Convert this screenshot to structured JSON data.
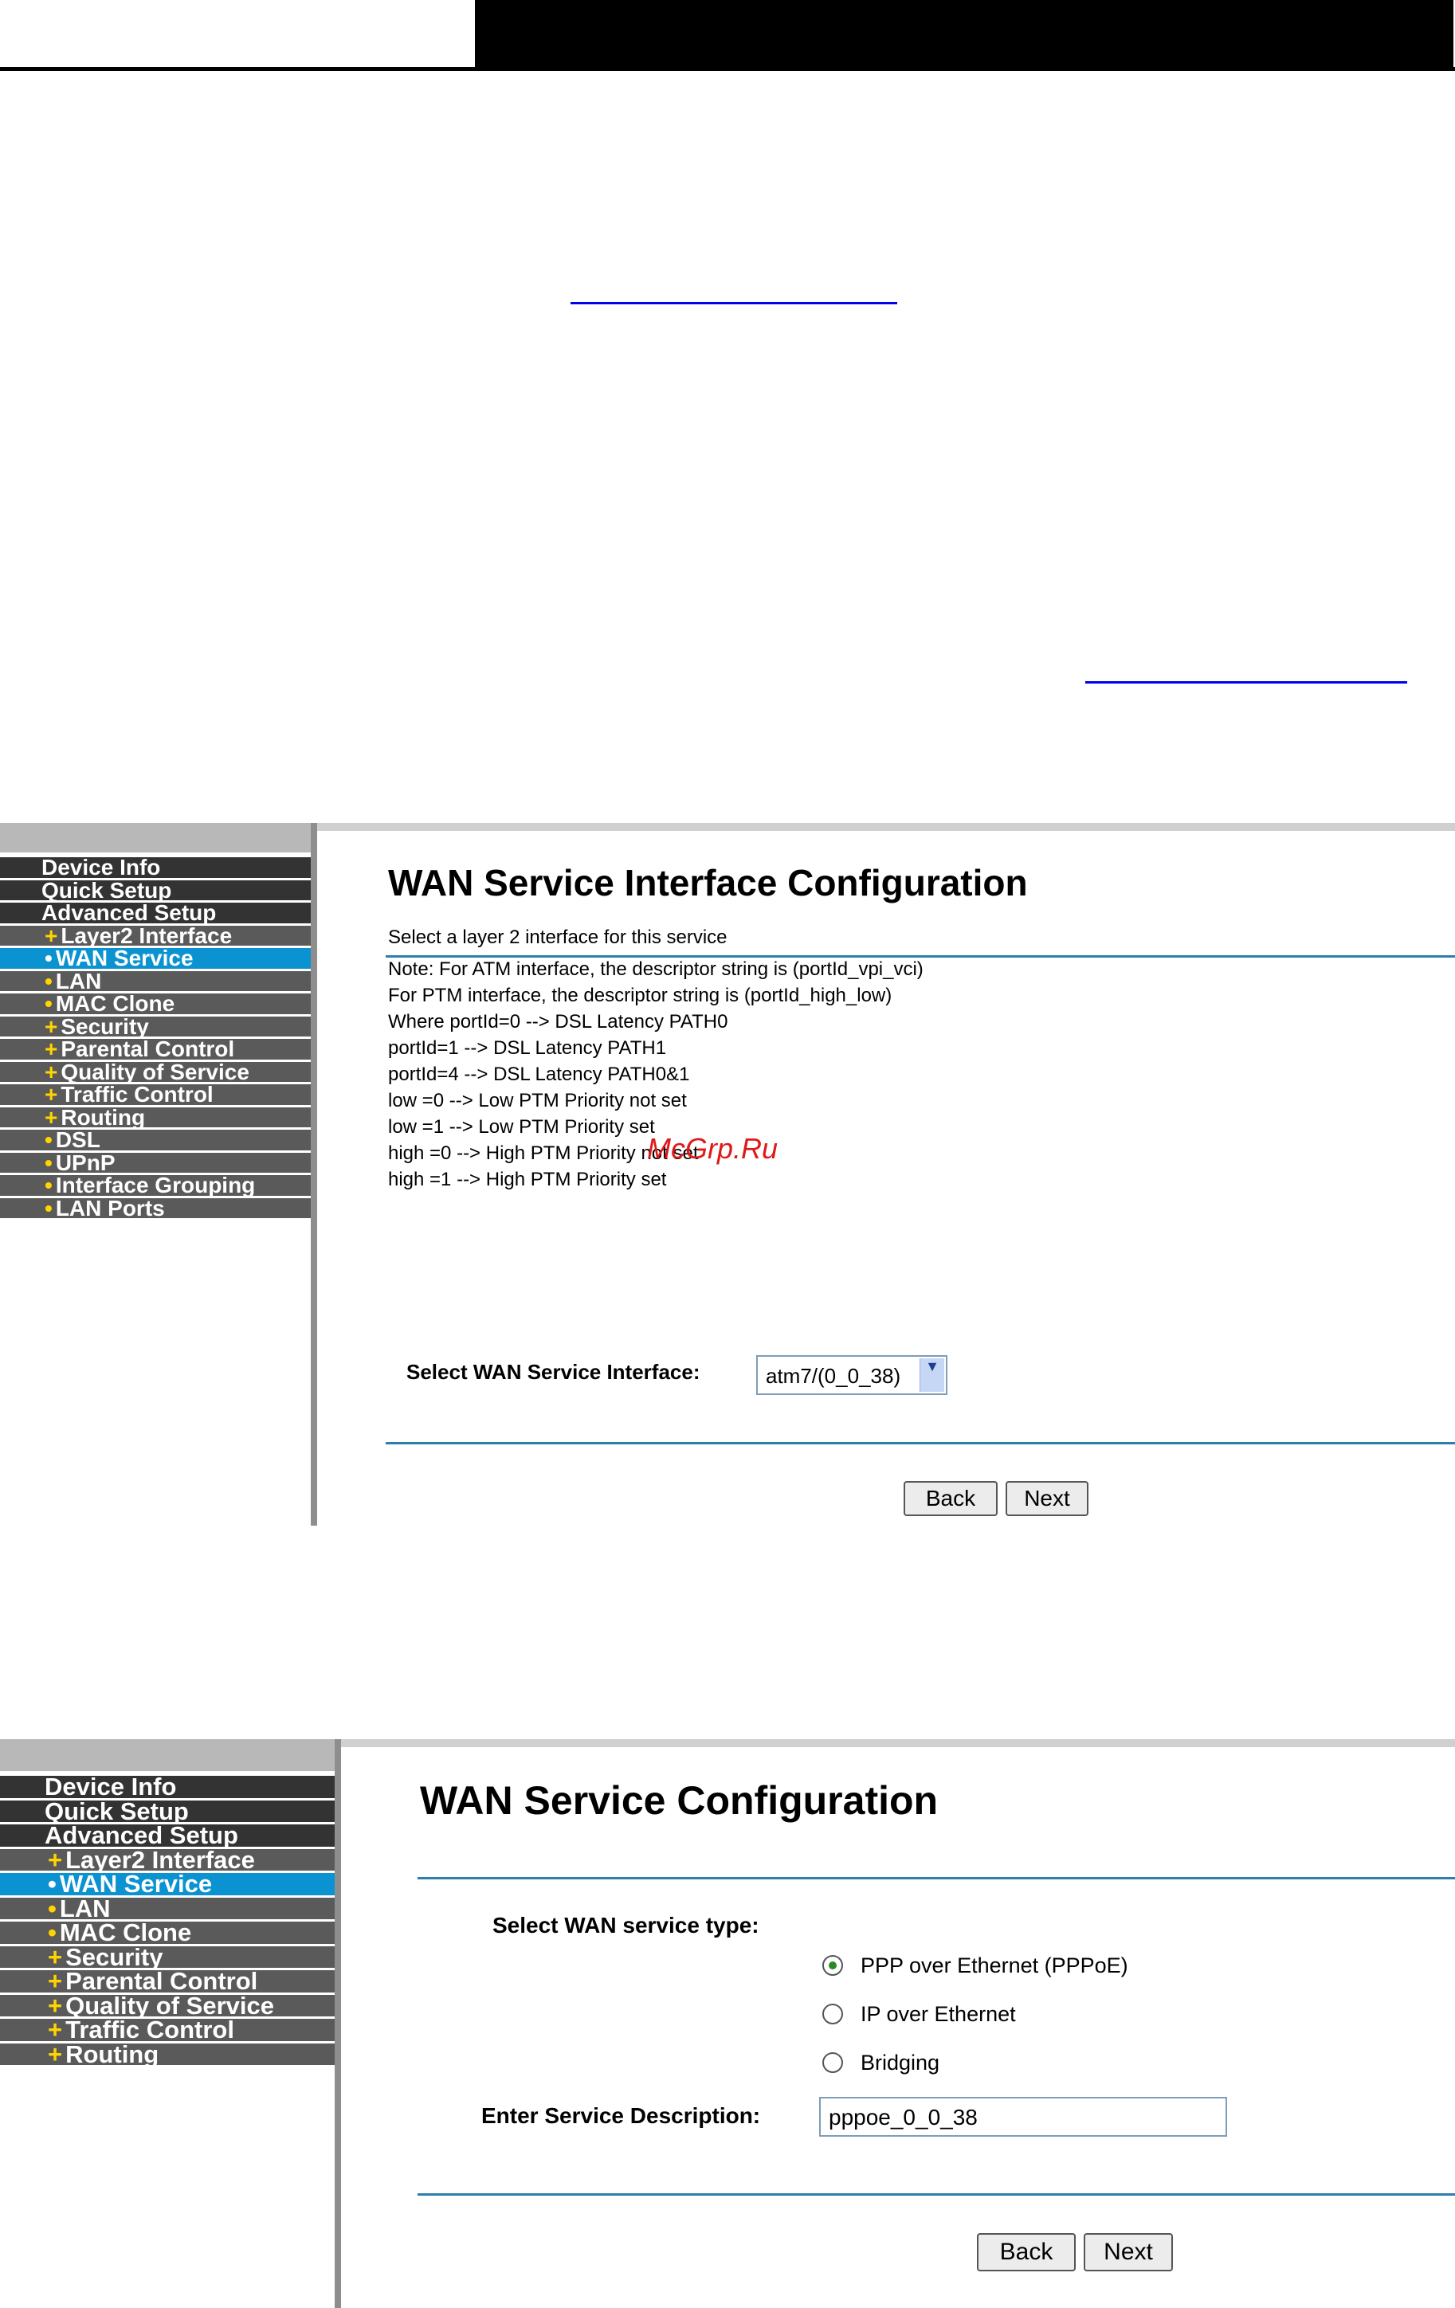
{
  "panel1": {
    "menu": [
      {
        "label": "Device Info",
        "kind": "main",
        "bullet": ""
      },
      {
        "label": "Quick Setup",
        "kind": "main",
        "bullet": ""
      },
      {
        "label": "Advanced Setup",
        "kind": "main",
        "bullet": ""
      },
      {
        "label": "Layer2 Interface",
        "kind": "sub",
        "bullet": "+"
      },
      {
        "label": "WAN Service",
        "kind": "active",
        "bullet": "•"
      },
      {
        "label": "LAN",
        "kind": "sub",
        "bullet": "•"
      },
      {
        "label": "MAC Clone",
        "kind": "sub",
        "bullet": "•"
      },
      {
        "label": "Security",
        "kind": "sub",
        "bullet": "+"
      },
      {
        "label": "Parental Control",
        "kind": "sub",
        "bullet": "+"
      },
      {
        "label": "Quality of Service",
        "kind": "sub",
        "bullet": "+"
      },
      {
        "label": "Traffic Control",
        "kind": "sub",
        "bullet": "+"
      },
      {
        "label": "Routing",
        "kind": "sub",
        "bullet": "+"
      },
      {
        "label": "DSL",
        "kind": "sub",
        "bullet": "•"
      },
      {
        "label": "UPnP",
        "kind": "sub",
        "bullet": "•"
      },
      {
        "label": "Interface Grouping",
        "kind": "sub",
        "bullet": "•"
      },
      {
        "label": "LAN Ports",
        "kind": "sub",
        "bullet": "•"
      }
    ],
    "title": "WAN Service Interface Configuration",
    "lines": [
      "Select a layer 2 interface for this service",
      "Note: For ATM interface, the descriptor string is (portId_vpi_vci)",
      "For PTM interface, the descriptor string is (portId_high_low)",
      "Where portId=0 --> DSL Latency PATH0",
      "portId=1 --> DSL Latency PATH1",
      "portId=4 --> DSL Latency PATH0&1",
      "low =0 --> Low PTM Priority not set",
      "low =1 --> Low PTM Priority set",
      "high =0 --> High PTM Priority not set",
      "high =1 --> High PTM Priority set"
    ],
    "select_label": "Select WAN Service Interface:",
    "select_value": "atm7/(0_0_38)",
    "back": "Back",
    "next": "Next",
    "watermark": "McGrp.Ru"
  },
  "panel2": {
    "menu": [
      {
        "label": "Device Info",
        "kind": "main",
        "bullet": ""
      },
      {
        "label": "Quick Setup",
        "kind": "main",
        "bullet": ""
      },
      {
        "label": "Advanced Setup",
        "kind": "main",
        "bullet": ""
      },
      {
        "label": "Layer2 Interface",
        "kind": "sub",
        "bullet": "+"
      },
      {
        "label": "WAN Service",
        "kind": "active",
        "bullet": "•"
      },
      {
        "label": "LAN",
        "kind": "sub",
        "bullet": "•"
      },
      {
        "label": "MAC Clone",
        "kind": "sub",
        "bullet": "•"
      },
      {
        "label": "Security",
        "kind": "sub",
        "bullet": "+"
      },
      {
        "label": "Parental Control",
        "kind": "sub",
        "bullet": "+"
      },
      {
        "label": "Quality of Service",
        "kind": "sub",
        "bullet": "+"
      },
      {
        "label": "Traffic Control",
        "kind": "sub",
        "bullet": "+"
      },
      {
        "label": "Routing",
        "kind": "sub",
        "bullet": "+"
      }
    ],
    "title": "WAN Service Configuration",
    "type_label": "Select WAN service type:",
    "options": [
      {
        "label": "PPP over Ethernet (PPPoE)",
        "selected": true
      },
      {
        "label": "IP over Ethernet",
        "selected": false
      },
      {
        "label": "Bridging",
        "selected": false
      }
    ],
    "desc_label": "Enter Service Description:",
    "desc_value": "pppoe_0_0_38",
    "back": "Back",
    "next": "Next"
  }
}
